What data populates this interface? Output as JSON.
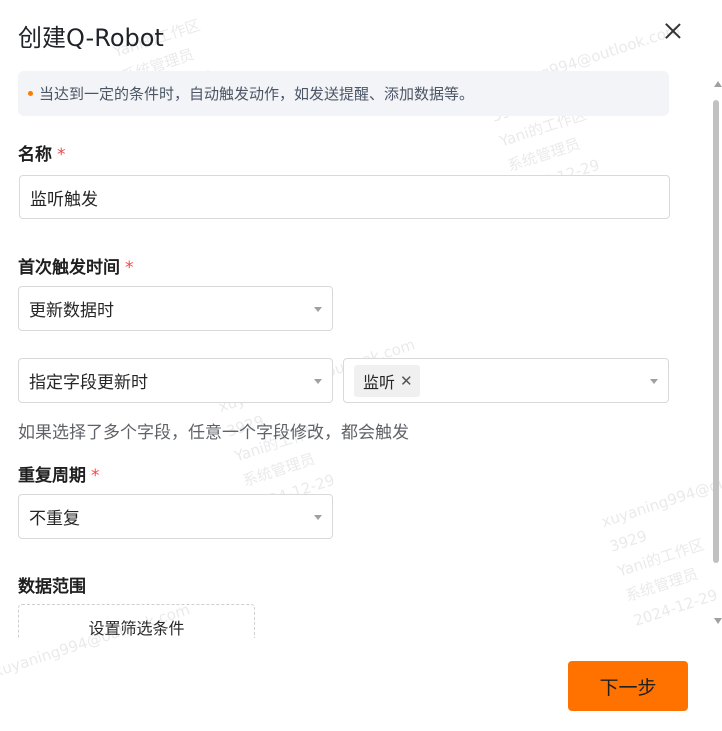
{
  "dialog": {
    "title": "创建Q-Robot",
    "info_text": "当达到一定的条件时，自动触发动作，如发送提醒、添加数据等。"
  },
  "form": {
    "name": {
      "label": "名称",
      "required_mark": "*",
      "value": "监听触发"
    },
    "first_trigger": {
      "label": "首次触发时间",
      "required_mark": "*",
      "selected": "更新数据时",
      "condition_selected": "指定字段更新时",
      "fields_tags": [
        "监听"
      ],
      "hint": "如果选择了多个字段，任意一个字段修改，都会触发"
    },
    "repeat": {
      "label": "重复周期",
      "required_mark": "*",
      "selected": "不重复"
    },
    "data_range": {
      "label": "数据范围",
      "button_label": "设置筛选条件"
    }
  },
  "footer": {
    "next_label": "下一步"
  },
  "watermark": {
    "user": "xuyaning994@outlook.com",
    "id": "3929",
    "org": "Yani的工作区",
    "role": "系统管理员",
    "date": "2024-12-29"
  },
  "colors": {
    "accent": "#ff7200",
    "required": "#f5484a",
    "info_bg": "#f3f4f8"
  },
  "icons": {
    "close": "close-icon",
    "caret": "caret-down-icon",
    "tag_remove": "tag-remove-icon"
  }
}
